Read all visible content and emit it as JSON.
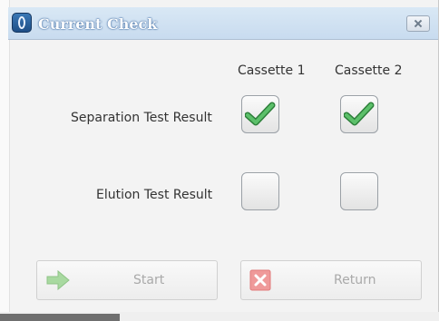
{
  "window": {
    "title": "Current Check"
  },
  "columns": [
    "Cassette 1",
    "Cassette 2"
  ],
  "rows": [
    {
      "label": "Separation Test Result",
      "cassette1_checked": true,
      "cassette2_checked": true
    },
    {
      "label": "Elution Test Result",
      "cassette1_checked": false,
      "cassette2_checked": false
    }
  ],
  "buttons": {
    "start": {
      "label": "Start",
      "icon": "arrow-right-icon",
      "enabled": false
    },
    "return": {
      "label": "Return",
      "icon": "close-x-icon",
      "enabled": false
    }
  },
  "colors": {
    "check_green": "#3fa34d",
    "title_bar": "#c8dbef",
    "return_icon_red": "#e56b6b"
  }
}
